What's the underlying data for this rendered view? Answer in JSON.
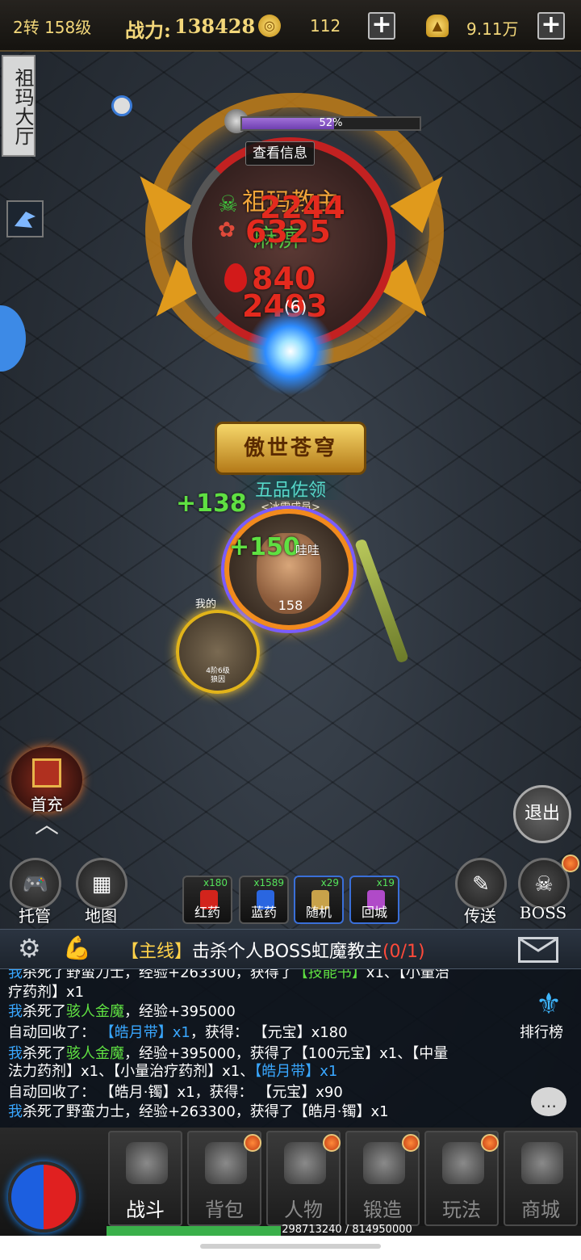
{
  "topbar": {
    "level": "2转 158级",
    "power_label": "战力:",
    "power_value": "138428",
    "gold_icon": "coin-icon",
    "gold_value": "112",
    "ingot_icon": "ingot-icon",
    "ingot_value": "9.11万",
    "plus": "+"
  },
  "map": {
    "name": "祖玛大厅"
  },
  "boss": {
    "hp_percent": 52,
    "hp_text": "52%",
    "view_info": "查看信息",
    "name": "祖玛教主",
    "status": "麻痹",
    "timer": "(6)",
    "damage": [
      "2244",
      "6325",
      "840",
      "2493"
    ]
  },
  "player": {
    "guild_banner": "傲世苍穹",
    "rank": "五品佐领",
    "guild": "<冰雪成员>",
    "name": "哇哇",
    "level": "158",
    "heals": [
      "+138",
      "+150"
    ],
    "pet_owner": "我的",
    "pet_info_1": "4阶6级",
    "pet_info_2": "狼因"
  },
  "buttons": {
    "first_charge": "首充",
    "exit": "退出",
    "auto": "托管",
    "map": "地图",
    "teleport": "传送",
    "boss": "BOSS",
    "ranking": "排行榜"
  },
  "potions": [
    {
      "label": "红药",
      "count": "x180",
      "color": "#d2241c"
    },
    {
      "label": "蓝药",
      "count": "x1589",
      "color": "#2a66e0"
    },
    {
      "label": "随机",
      "count": "x29",
      "color": "#c8a24a"
    },
    {
      "label": "回城",
      "count": "x19",
      "color": "#b04ac8"
    }
  ],
  "quest": {
    "tag": "【主线】",
    "text": "击杀个人BOSS虹魔教主",
    "progress": "(0/1)"
  },
  "chat": [
    [
      {
        "t": "我",
        "c": "c-blue"
      },
      {
        "t": "杀死了野蛮力士，经验+263300，获得了"
      },
      {
        "t": "【技能书】",
        "c": "c-green"
      },
      {
        "t": "x1、【小量治"
      }
    ],
    [
      {
        "t": "疗药剂】x1"
      }
    ],
    [
      {
        "t": "我",
        "c": "c-blue"
      },
      {
        "t": "杀死了"
      },
      {
        "t": "骇人金魔",
        "c": "c-green"
      },
      {
        "t": "，经验+395000"
      }
    ],
    [
      {
        "t": "自动回收了：  "
      },
      {
        "t": "【皓月带】x1",
        "c": "c-blue"
      },
      {
        "t": "，获得：  【元宝】x180"
      }
    ],
    [
      {
        "t": "我",
        "c": "c-blue"
      },
      {
        "t": "杀死了"
      },
      {
        "t": "骇人金魔",
        "c": "c-green"
      },
      {
        "t": "，经验+395000，获得了【100元宝】x1、【中量"
      }
    ],
    [
      {
        "t": "法力药剂】x1、【小量治疗药剂】x1、"
      },
      {
        "t": "【皓月带】x1",
        "c": "c-blue"
      }
    ],
    [
      {
        "t": "自动回收了：  【皓月·镯】x1，获得：  【元宝】x90"
      }
    ],
    [
      {
        "t": "我",
        "c": "c-blue"
      },
      {
        "t": "杀死了野蛮力士，经验+263300，获得了【皓月·镯】x1"
      }
    ]
  ],
  "nav": [
    {
      "label": "战斗",
      "icon": "swords-icon",
      "active": true
    },
    {
      "label": "背包",
      "icon": "backpack-icon",
      "badge": true
    },
    {
      "label": "人物",
      "icon": "helmet-icon",
      "badge": true
    },
    {
      "label": "锻造",
      "icon": "anvil-icon",
      "badge": true
    },
    {
      "label": "玩法",
      "icon": "wings-icon",
      "badge": true
    },
    {
      "label": "商城",
      "icon": "shop-icon"
    }
  ],
  "exp": {
    "text": "298713240 / 814950000",
    "ratio": 0.3665
  }
}
